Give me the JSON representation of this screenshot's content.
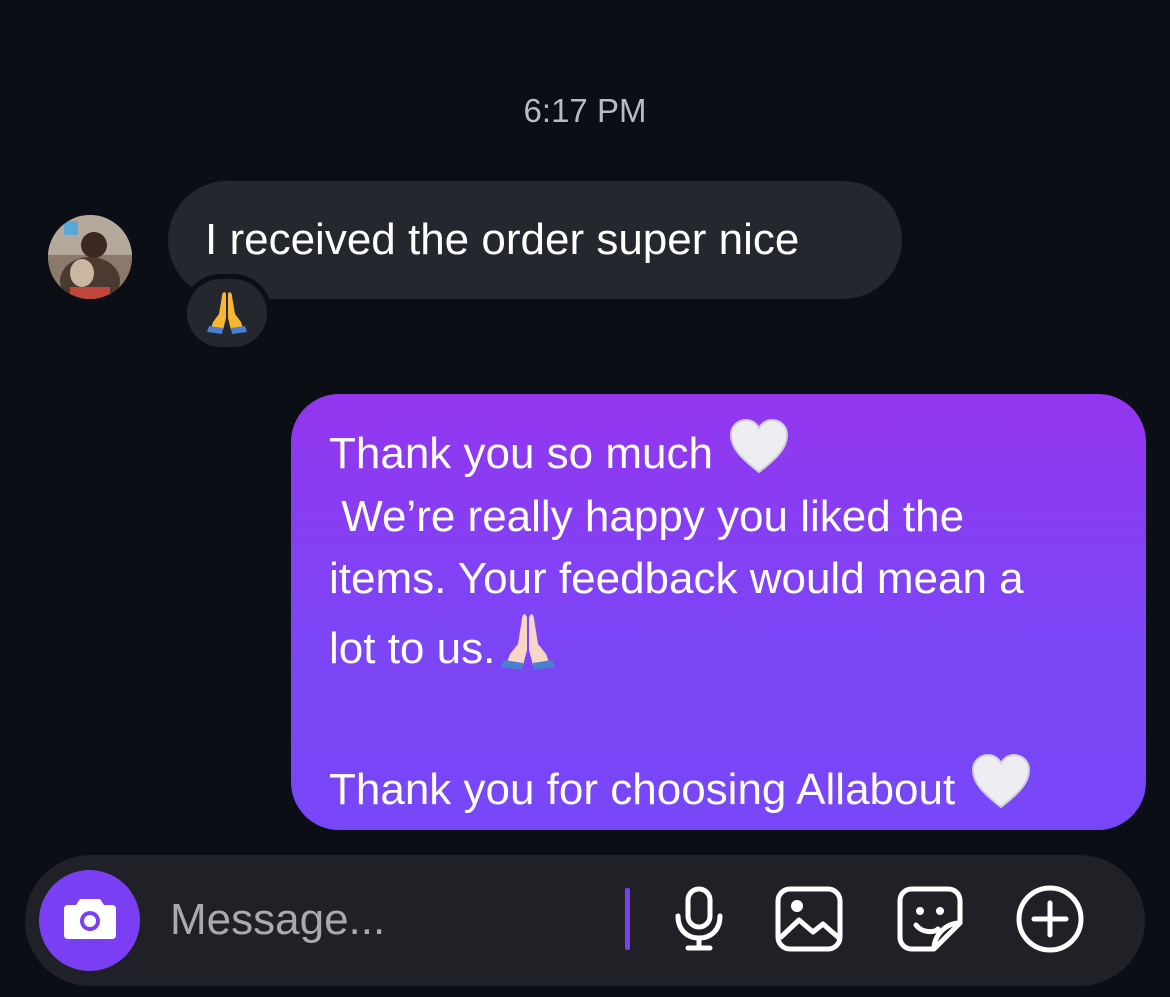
{
  "thread": {
    "timestamp": "6:17 PM"
  },
  "incoming": {
    "text": "I received the order super nice",
    "reaction": "praying-hands-emoji"
  },
  "outgoing": {
    "line1": "Thank you so much",
    "line2": " We’re really happy you liked the",
    "line3": "items. Your feedback would mean a",
    "line4": "lot to us.",
    "line5": "",
    "line6": "Thank you for choosing Allabout",
    "emoji_heart": "white-heart-emoji",
    "emoji_pray": "praying-hands-light-emoji"
  },
  "composer": {
    "placeholder": "Message...",
    "icons": [
      "camera-icon",
      "microphone-icon",
      "gallery-icon",
      "sticker-icon",
      "add-icon"
    ]
  },
  "colors": {
    "background": "#0c0e15",
    "incoming_bubble": "#25272e",
    "outgoing_top": "#9336ef",
    "outgoing_bottom": "#7747f7",
    "accent": "#7b3ff3"
  }
}
